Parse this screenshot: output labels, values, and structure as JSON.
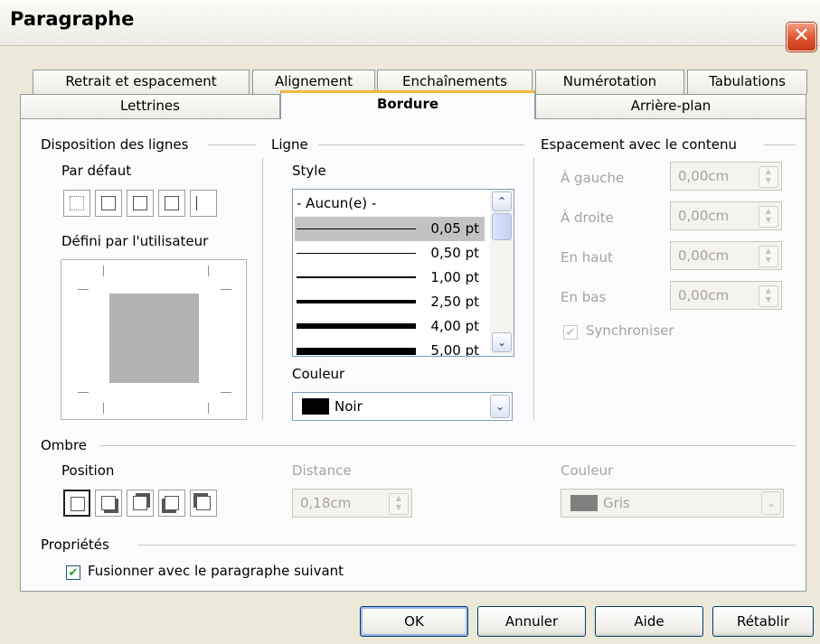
{
  "window": {
    "title": "Paragraphe",
    "close_symbol": "✕"
  },
  "tabs_row1": [
    "Retrait et espacement",
    "Alignement",
    "Enchaînements",
    "Numérotation",
    "Tabulations"
  ],
  "tabs_row2": [
    "Lettrines",
    "Bordure",
    "Arrière-plan"
  ],
  "active_tab": "Bordure",
  "line_arrangement": {
    "heading": "Disposition des lignes",
    "default_label": "Par défaut",
    "user_defined_label": "Défini par l'utilisateur"
  },
  "line": {
    "heading": "Ligne",
    "style_label": "Style",
    "styles": [
      "- Aucun(e) -",
      "0,05 pt",
      "0,50 pt",
      "1,00 pt",
      "2,50 pt",
      "4,00 pt",
      "5,00 pt"
    ],
    "selected_style": "0,05 pt",
    "color_label": "Couleur",
    "color_value": "Noir",
    "color_hex": "#000000"
  },
  "spacing": {
    "heading": "Espacement avec le contenu",
    "left_label": "À gauche",
    "left_value": "0,00cm",
    "right_label": "À droite",
    "right_value": "0,00cm",
    "top_label": "En haut",
    "top_value": "0,00cm",
    "bottom_label": "En bas",
    "bottom_value": "0,00cm",
    "sync_label": "Synchroniser",
    "sync_checked": true
  },
  "shadow": {
    "heading": "Ombre",
    "position_label": "Position",
    "distance_label": "Distance",
    "distance_value": "0,18cm",
    "color_label": "Couleur",
    "color_value": "Gris",
    "color_hex": "#808080"
  },
  "properties": {
    "heading": "Propriétés",
    "merge_label": "Fusionner avec le paragraphe suivant",
    "merge_checked": true
  },
  "buttons": {
    "ok": "OK",
    "cancel": "Annuler",
    "help": "Aide",
    "reset": "Rétablir"
  },
  "icons": {
    "checkmark": "✔",
    "arrow_up": "⌃",
    "arrow_down": "⌄"
  }
}
